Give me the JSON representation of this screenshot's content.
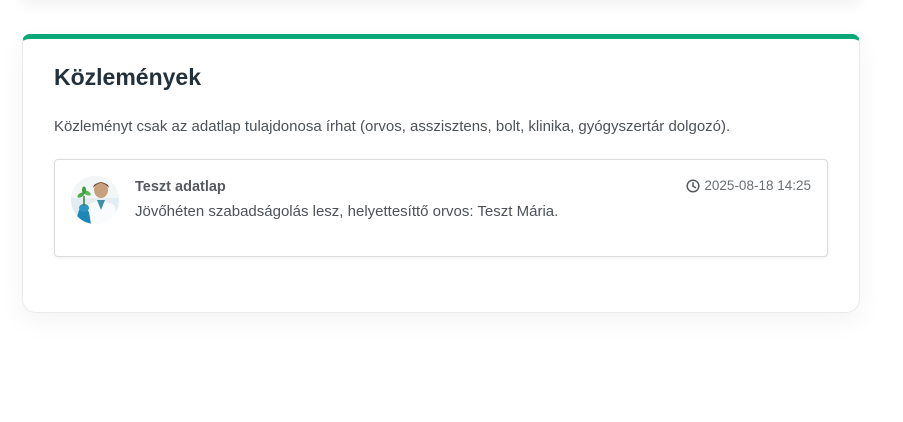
{
  "announcements": {
    "title": "Közlemények",
    "description": "Közleményt csak az adatlap tulajdonosa írhat (orvos, asszisztens, bolt, klinika, gyógyszertár dolgozó).",
    "posts": [
      {
        "author": "Teszt adatlap",
        "timestamp": "2025-08-18 14:25",
        "text": "Jövőhéten szabadságolás lesz, helyettesíttő orvos: Teszt Mária.",
        "icon": "clock-icon"
      }
    ]
  },
  "colors": {
    "accent": "#0aa876",
    "title": "#23313c",
    "text": "#4c5258"
  }
}
